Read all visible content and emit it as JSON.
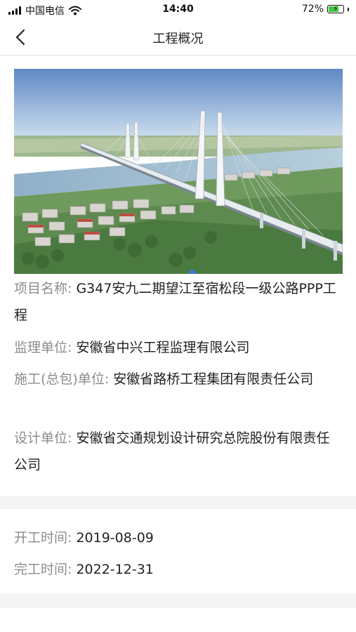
{
  "status_bar": {
    "carrier": "中国电信",
    "time": "14:40",
    "battery_percent": "72%",
    "battery_level": 0.72
  },
  "nav": {
    "title": "工程概况",
    "back_icon": "chevron-left-icon"
  },
  "project": {
    "carousel_total": 1,
    "carousel_active": 1,
    "name_label": "项目名称:",
    "name_value": "G347安九二期望江至宿松段一级公路PPP工程",
    "supervisor_label": "监理单位:",
    "supervisor_value": "安徽省中兴工程监理有限公司",
    "contractor_label": "施工(总包)单位:",
    "contractor_value": "安徽省路桥工程集团有限责任公司",
    "designer_label": "设计单位:",
    "designer_value": "安徽省交通规划设计研究总院股份有限责任公司"
  },
  "dates": {
    "start_label": "开工时间:",
    "start_value": "2019-08-09",
    "end_label": "完工时间:",
    "end_value": "2022-12-31"
  },
  "colors": {
    "accent": "#3a7bd5",
    "label_gray": "#8c8c8c",
    "battery_green": "#3ec93e"
  }
}
